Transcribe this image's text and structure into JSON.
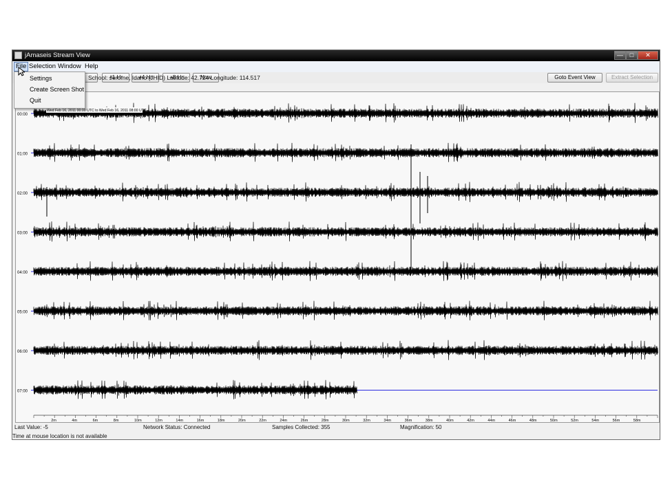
{
  "window": {
    "title": "jAmaseis Stream View",
    "controls": {
      "minimize": "—",
      "maximize": "□",
      "close": "✕"
    }
  },
  "menubar": {
    "items": [
      {
        "label": "File",
        "active": true
      },
      {
        "label": "Selection"
      },
      {
        "label": "Window"
      },
      {
        "label": "Help"
      }
    ]
  },
  "file_menu": {
    "items": [
      "Settings",
      "Create Screen Shot",
      "Quit"
    ]
  },
  "toolbar": {
    "plus1": "+1 Hr",
    "plus4": "+4 Hr",
    "plus8": "+8 Hr",
    "now": "Now",
    "goto_event": "Goto Event View",
    "extract": "Extract Selection",
    "station_info": "School: Jerome, Idaho (JHID) Latitude: 42.724 Longitude: 114.517"
  },
  "plot": {
    "date_range_label": "Wed Feb 16, 2011 00:00 UTC to Wed Feb 16, 2011 08:00 UTC",
    "row_labels": [
      "00:00",
      "01:00",
      "02:00",
      "03:00",
      "04:00",
      "05:00",
      "06:00",
      "07:00"
    ],
    "x_ticks": [
      "2m",
      "4m",
      "6m",
      "8m",
      "10m",
      "12m",
      "14m",
      "16m",
      "18m",
      "20m",
      "22m",
      "24m",
      "26m",
      "28m",
      "30m",
      "32m",
      "34m",
      "36m",
      "38m",
      "40m",
      "42m",
      "44m",
      "46m",
      "48m",
      "50m",
      "52m",
      "54m",
      "56m",
      "58m"
    ],
    "trace_color": "#000000",
    "baseline_color": "#2a2adf"
  },
  "status": {
    "last_value": "Last Value:  -5",
    "network": "Network Status:  Connected",
    "samples": "Samples Collected:  355",
    "magnification": "Magnification:  50",
    "mouse_time": "Time at mouse location is not available"
  }
}
